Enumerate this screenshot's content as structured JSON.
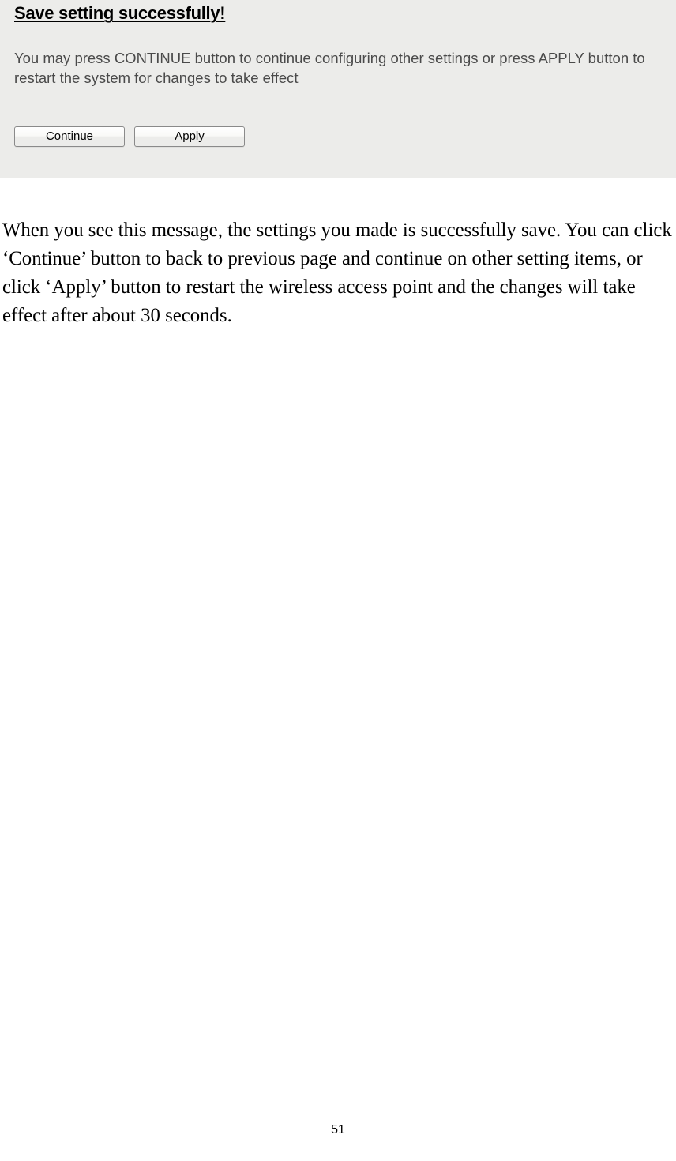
{
  "dialog": {
    "heading": "Save setting successfully!",
    "message": "You may press CONTINUE button to continue configuring other settings or press APPLY button to restart the system for changes to take effect",
    "continue_label": "Continue",
    "apply_label": "Apply"
  },
  "body": {
    "paragraph": "When you see this message, the settings you made is successfully save. You can click ‘Continue’ button to back to previous page and continue on other setting items, or click ‘Apply’ button to restart the wireless access point and the changes will take effect after about 30 seconds."
  },
  "page_number": "51"
}
